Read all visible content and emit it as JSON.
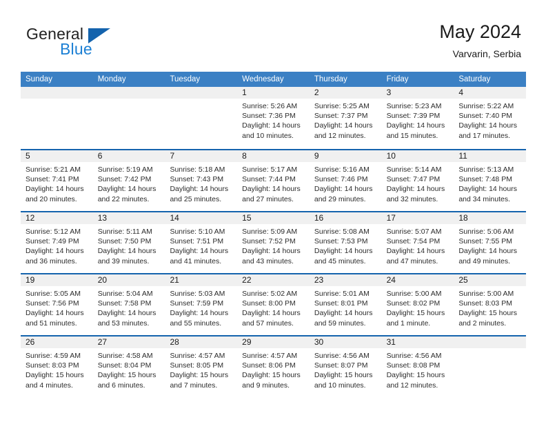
{
  "brand": {
    "name_part1": "General",
    "name_part2": "Blue",
    "accent_color": "#1b7fd4",
    "logo_triangle_color": "#1463ad"
  },
  "header": {
    "title": "May 2024",
    "subtitle": "Varvarin, Serbia"
  },
  "calendar": {
    "header_bg": "#3b80c4",
    "row_line_color": "#1463ad",
    "day_band_color": "#f0f0f0",
    "weekdays": [
      "Sunday",
      "Monday",
      "Tuesday",
      "Wednesday",
      "Thursday",
      "Friday",
      "Saturday"
    ],
    "weeks": [
      [
        {
          "day": "",
          "sunrise": "",
          "sunset": "",
          "daylight1": "",
          "daylight2": ""
        },
        {
          "day": "",
          "sunrise": "",
          "sunset": "",
          "daylight1": "",
          "daylight2": ""
        },
        {
          "day": "",
          "sunrise": "",
          "sunset": "",
          "daylight1": "",
          "daylight2": ""
        },
        {
          "day": "1",
          "sunrise": "Sunrise: 5:26 AM",
          "sunset": "Sunset: 7:36 PM",
          "daylight1": "Daylight: 14 hours",
          "daylight2": "and 10 minutes."
        },
        {
          "day": "2",
          "sunrise": "Sunrise: 5:25 AM",
          "sunset": "Sunset: 7:37 PM",
          "daylight1": "Daylight: 14 hours",
          "daylight2": "and 12 minutes."
        },
        {
          "day": "3",
          "sunrise": "Sunrise: 5:23 AM",
          "sunset": "Sunset: 7:39 PM",
          "daylight1": "Daylight: 14 hours",
          "daylight2": "and 15 minutes."
        },
        {
          "day": "4",
          "sunrise": "Sunrise: 5:22 AM",
          "sunset": "Sunset: 7:40 PM",
          "daylight1": "Daylight: 14 hours",
          "daylight2": "and 17 minutes."
        }
      ],
      [
        {
          "day": "5",
          "sunrise": "Sunrise: 5:21 AM",
          "sunset": "Sunset: 7:41 PM",
          "daylight1": "Daylight: 14 hours",
          "daylight2": "and 20 minutes."
        },
        {
          "day": "6",
          "sunrise": "Sunrise: 5:19 AM",
          "sunset": "Sunset: 7:42 PM",
          "daylight1": "Daylight: 14 hours",
          "daylight2": "and 22 minutes."
        },
        {
          "day": "7",
          "sunrise": "Sunrise: 5:18 AM",
          "sunset": "Sunset: 7:43 PM",
          "daylight1": "Daylight: 14 hours",
          "daylight2": "and 25 minutes."
        },
        {
          "day": "8",
          "sunrise": "Sunrise: 5:17 AM",
          "sunset": "Sunset: 7:44 PM",
          "daylight1": "Daylight: 14 hours",
          "daylight2": "and 27 minutes."
        },
        {
          "day": "9",
          "sunrise": "Sunrise: 5:16 AM",
          "sunset": "Sunset: 7:46 PM",
          "daylight1": "Daylight: 14 hours",
          "daylight2": "and 29 minutes."
        },
        {
          "day": "10",
          "sunrise": "Sunrise: 5:14 AM",
          "sunset": "Sunset: 7:47 PM",
          "daylight1": "Daylight: 14 hours",
          "daylight2": "and 32 minutes."
        },
        {
          "day": "11",
          "sunrise": "Sunrise: 5:13 AM",
          "sunset": "Sunset: 7:48 PM",
          "daylight1": "Daylight: 14 hours",
          "daylight2": "and 34 minutes."
        }
      ],
      [
        {
          "day": "12",
          "sunrise": "Sunrise: 5:12 AM",
          "sunset": "Sunset: 7:49 PM",
          "daylight1": "Daylight: 14 hours",
          "daylight2": "and 36 minutes."
        },
        {
          "day": "13",
          "sunrise": "Sunrise: 5:11 AM",
          "sunset": "Sunset: 7:50 PM",
          "daylight1": "Daylight: 14 hours",
          "daylight2": "and 39 minutes."
        },
        {
          "day": "14",
          "sunrise": "Sunrise: 5:10 AM",
          "sunset": "Sunset: 7:51 PM",
          "daylight1": "Daylight: 14 hours",
          "daylight2": "and 41 minutes."
        },
        {
          "day": "15",
          "sunrise": "Sunrise: 5:09 AM",
          "sunset": "Sunset: 7:52 PM",
          "daylight1": "Daylight: 14 hours",
          "daylight2": "and 43 minutes."
        },
        {
          "day": "16",
          "sunrise": "Sunrise: 5:08 AM",
          "sunset": "Sunset: 7:53 PM",
          "daylight1": "Daylight: 14 hours",
          "daylight2": "and 45 minutes."
        },
        {
          "day": "17",
          "sunrise": "Sunrise: 5:07 AM",
          "sunset": "Sunset: 7:54 PM",
          "daylight1": "Daylight: 14 hours",
          "daylight2": "and 47 minutes."
        },
        {
          "day": "18",
          "sunrise": "Sunrise: 5:06 AM",
          "sunset": "Sunset: 7:55 PM",
          "daylight1": "Daylight: 14 hours",
          "daylight2": "and 49 minutes."
        }
      ],
      [
        {
          "day": "19",
          "sunrise": "Sunrise: 5:05 AM",
          "sunset": "Sunset: 7:56 PM",
          "daylight1": "Daylight: 14 hours",
          "daylight2": "and 51 minutes."
        },
        {
          "day": "20",
          "sunrise": "Sunrise: 5:04 AM",
          "sunset": "Sunset: 7:58 PM",
          "daylight1": "Daylight: 14 hours",
          "daylight2": "and 53 minutes."
        },
        {
          "day": "21",
          "sunrise": "Sunrise: 5:03 AM",
          "sunset": "Sunset: 7:59 PM",
          "daylight1": "Daylight: 14 hours",
          "daylight2": "and 55 minutes."
        },
        {
          "day": "22",
          "sunrise": "Sunrise: 5:02 AM",
          "sunset": "Sunset: 8:00 PM",
          "daylight1": "Daylight: 14 hours",
          "daylight2": "and 57 minutes."
        },
        {
          "day": "23",
          "sunrise": "Sunrise: 5:01 AM",
          "sunset": "Sunset: 8:01 PM",
          "daylight1": "Daylight: 14 hours",
          "daylight2": "and 59 minutes."
        },
        {
          "day": "24",
          "sunrise": "Sunrise: 5:00 AM",
          "sunset": "Sunset: 8:02 PM",
          "daylight1": "Daylight: 15 hours",
          "daylight2": "and 1 minute."
        },
        {
          "day": "25",
          "sunrise": "Sunrise: 5:00 AM",
          "sunset": "Sunset: 8:03 PM",
          "daylight1": "Daylight: 15 hours",
          "daylight2": "and 2 minutes."
        }
      ],
      [
        {
          "day": "26",
          "sunrise": "Sunrise: 4:59 AM",
          "sunset": "Sunset: 8:03 PM",
          "daylight1": "Daylight: 15 hours",
          "daylight2": "and 4 minutes."
        },
        {
          "day": "27",
          "sunrise": "Sunrise: 4:58 AM",
          "sunset": "Sunset: 8:04 PM",
          "daylight1": "Daylight: 15 hours",
          "daylight2": "and 6 minutes."
        },
        {
          "day": "28",
          "sunrise": "Sunrise: 4:57 AM",
          "sunset": "Sunset: 8:05 PM",
          "daylight1": "Daylight: 15 hours",
          "daylight2": "and 7 minutes."
        },
        {
          "day": "29",
          "sunrise": "Sunrise: 4:57 AM",
          "sunset": "Sunset: 8:06 PM",
          "daylight1": "Daylight: 15 hours",
          "daylight2": "and 9 minutes."
        },
        {
          "day": "30",
          "sunrise": "Sunrise: 4:56 AM",
          "sunset": "Sunset: 8:07 PM",
          "daylight1": "Daylight: 15 hours",
          "daylight2": "and 10 minutes."
        },
        {
          "day": "31",
          "sunrise": "Sunrise: 4:56 AM",
          "sunset": "Sunset: 8:08 PM",
          "daylight1": "Daylight: 15 hours",
          "daylight2": "and 12 minutes."
        },
        {
          "day": "",
          "sunrise": "",
          "sunset": "",
          "daylight1": "",
          "daylight2": ""
        }
      ]
    ]
  }
}
